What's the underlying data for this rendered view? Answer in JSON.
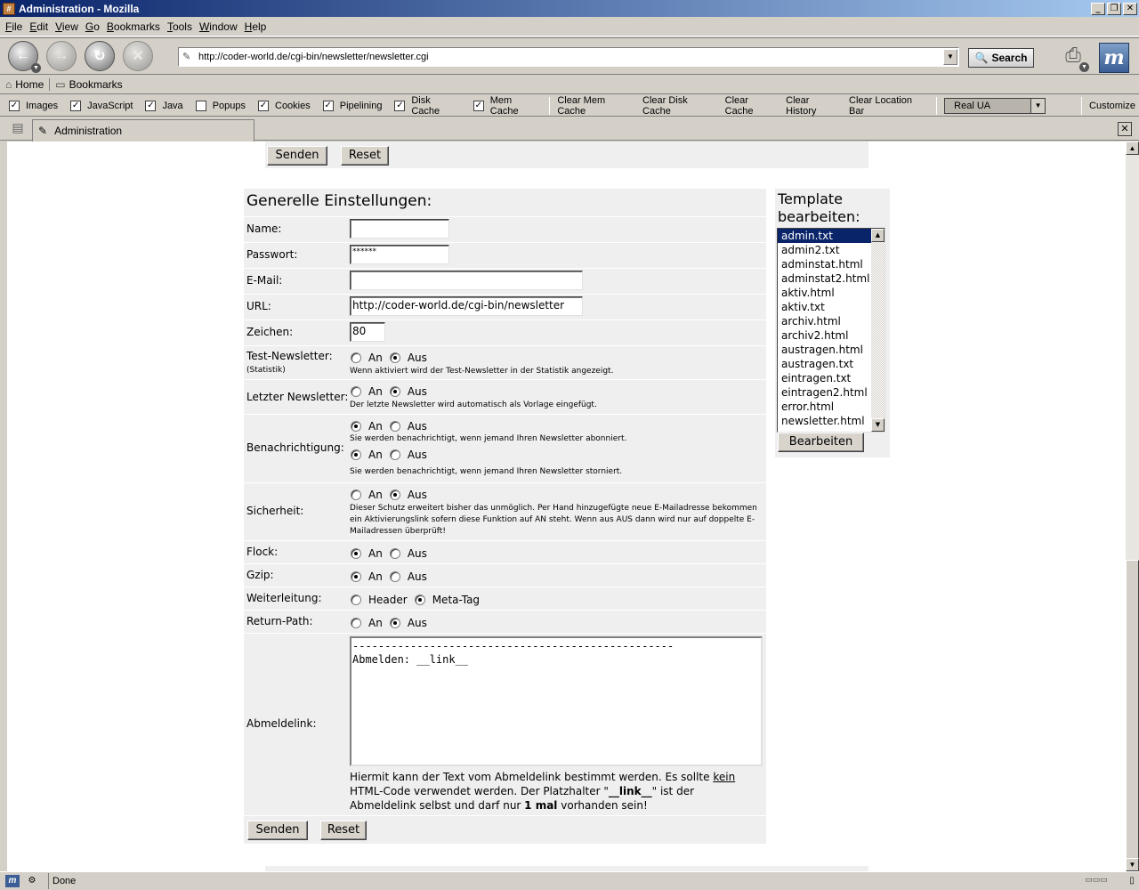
{
  "window": {
    "title": "Administration - Mozilla",
    "controls": [
      "_",
      "❐",
      "✕"
    ]
  },
  "menu": [
    "File",
    "Edit",
    "View",
    "Go",
    "Bookmarks",
    "Tools",
    "Window",
    "Help"
  ],
  "nav": {
    "url": "http://coder-world.de/cgi-bin/newsletter/newsletter.cgi",
    "search_label": "Search"
  },
  "personal": {
    "home": "Home",
    "bookmarks": "Bookmarks"
  },
  "prefbar": {
    "checks": [
      {
        "label": "Images",
        "checked": true
      },
      {
        "label": "JavaScript",
        "checked": true
      },
      {
        "label": "Java",
        "checked": true
      },
      {
        "label": "Popups",
        "checked": false
      },
      {
        "label": "Cookies",
        "checked": true
      },
      {
        "label": "Pipelining",
        "checked": true
      },
      {
        "label": "Disk Cache",
        "checked": true
      },
      {
        "label": "Mem Cache",
        "checked": true
      }
    ],
    "buttons": [
      "Clear Mem Cache",
      "Clear Disk Cache",
      "Clear Cache",
      "Clear History",
      "Clear Location Bar"
    ],
    "ua_select": "Real UA",
    "customize": "Customize"
  },
  "tab": {
    "title": "Administration"
  },
  "top_form": {
    "send": "Senden",
    "reset": "Reset"
  },
  "settings": {
    "heading": "Generelle Einstellungen:",
    "name_label": "Name:",
    "name_value": "",
    "password_label": "Passwort:",
    "password_value": "******",
    "email_label": "E-Mail:",
    "email_value": "",
    "url_label": "URL:",
    "url_value": "http://coder-world.de/cgi-bin/newsletter",
    "chars_label": "Zeichen:",
    "chars_value": "80",
    "test_label": "Test-Newsletter:",
    "test_sub": "(Statistik)",
    "test_note": "Wenn aktiviert wird der Test-Newsletter in der Statistik angezeigt.",
    "last_label": "Letzter Newsletter:",
    "last_note": "Der letzte Newsletter wird automatisch als Vorlage eingefügt.",
    "notify_label": "Benachrichtigung:",
    "notify_note1": "Sie werden benachrichtigt, wenn jemand Ihren Newsletter abonniert.",
    "notify_note2": "Sie werden benachrichtigt, wenn jemand Ihren Newsletter storniert.",
    "security_label": "Sicherheit:",
    "security_note": "Dieser Schutz erweitert bisher das unmöglich. Per Hand hinzugefügte neue E-Mailadresse bekommen ein Aktivierungslink sofern diese Funktion auf AN steht. Wenn aus AUS dann wird nur auf doppelte E-Mailadressen überprüft!",
    "flock_label": "Flock:",
    "gzip_label": "Gzip:",
    "redirect_label": "Weiterleitung:",
    "returnpath_label": "Return-Path:",
    "unsub_label": "Abmeldelink:",
    "unsub_text": "--------------------------------------------------\nAbmelden: __link__",
    "help_1": "Hiermit kann der Text vom Abmeldelink bestimmt werden. Es sollte ",
    "help_kein": "kein",
    "help_2": " HTML-Code verwendet werden. Der Platzhalter \"",
    "help_link": "__link__",
    "help_3": "\" ist der Abmeldelink selbst und darf nur ",
    "help_once": "1 mal",
    "help_4": " vorhanden sein!",
    "opt_an": "An",
    "opt_aus": "Aus",
    "opt_header": "Header",
    "opt_meta": "Meta-Tag",
    "send": "Senden",
    "reset": "Reset"
  },
  "template": {
    "title": "Template bearbeiten:",
    "files": [
      "admin.txt",
      "admin2.txt",
      "adminstat.html",
      "adminstat2.html",
      "aktiv.html",
      "aktiv.txt",
      "archiv.html",
      "archiv2.html",
      "austragen.html",
      "austragen.txt",
      "eintragen.txt",
      "eintragen2.html",
      "error.html",
      "newsletter.html"
    ],
    "selected": "admin.txt",
    "edit_button": "Bearbeiten"
  },
  "status": {
    "text": "Done"
  }
}
